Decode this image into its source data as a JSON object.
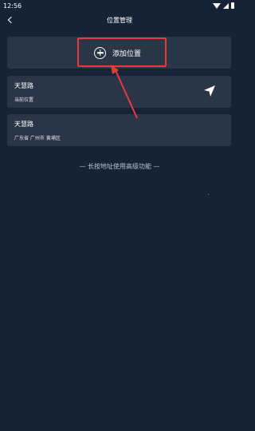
{
  "status_bar": {
    "time": "12:56"
  },
  "app_bar": {
    "title": "位置管理"
  },
  "add_location": {
    "label": "添加位置"
  },
  "locations": [
    {
      "name": "天慧路",
      "detail": "当前位置"
    },
    {
      "name": "天慧路",
      "detail": "广东省 广州市 黄埔区"
    }
  ],
  "hint": "— 长按地址使用高级功能 —",
  "colors": {
    "background": "#162236",
    "card": "#2a3648",
    "highlight": "#e83a3a"
  },
  "icons": [
    "back-icon",
    "add-circle-icon",
    "navigation-arrow-icon",
    "wifi-icon",
    "signal-icon",
    "battery-icon"
  ]
}
